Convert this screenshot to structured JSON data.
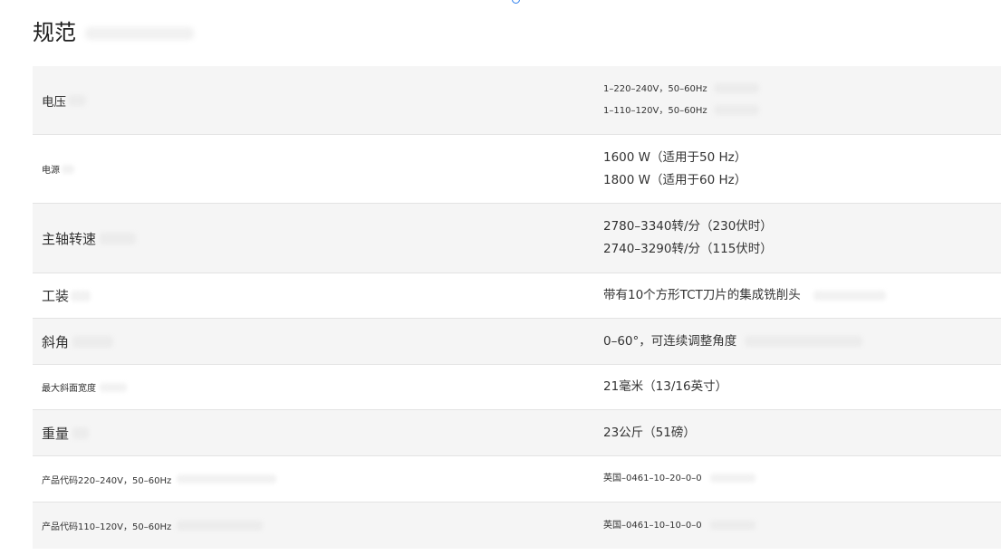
{
  "page": {
    "title": "规范"
  },
  "specs": {
    "voltage": {
      "label": "电压",
      "values": [
        "1–220–240V，50–60Hz",
        "1–110–120V，50–60Hz"
      ]
    },
    "power": {
      "label": "电源",
      "values": [
        "1600 W（适用于50 Hz）",
        "1800 W（适用于60 Hz）"
      ]
    },
    "spindle_speed": {
      "label": "主轴转速",
      "values": [
        "2780–3340转/分（230伏时）",
        "2740–3290转/分（115伏时）"
      ]
    },
    "tooling": {
      "label": "工装",
      "value": "带有10个方形TCT刀片的集成铣削头"
    },
    "bevel": {
      "label": "斜角",
      "value": "0–60°，可连续调整角度"
    },
    "max_bevel_width": {
      "label": "最大斜面宽度",
      "value": "21毫米（13/16英寸）"
    },
    "weight": {
      "label": "重量",
      "value": "23公斤（51磅）"
    },
    "product_code_220": {
      "label": "产品代码220–240V，50–60Hz",
      "value": "英国–0461–10–20–0–0"
    },
    "product_code_110": {
      "label": "产品代码110–120V，50–60Hz",
      "value": "英国–0461–10–10–0–0"
    }
  }
}
